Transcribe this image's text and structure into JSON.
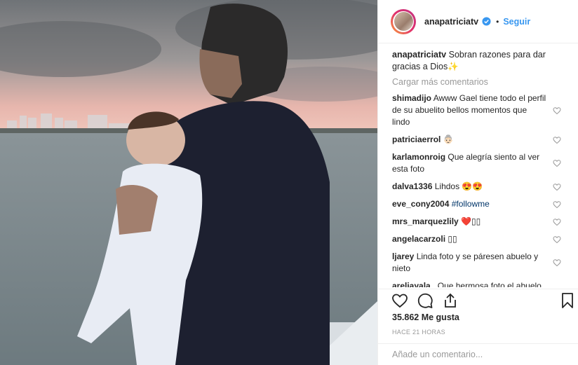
{
  "post": {
    "username": "anapatriciatv",
    "dot": "•",
    "follow_label": "Seguir"
  },
  "caption": {
    "username": "anapatriciatv",
    "text": "Sobran razones para dar gracias a Dios✨"
  },
  "load_more": "Cargar más comentarios",
  "comments": [
    {
      "user": "shimadijo",
      "text": "Awww Gael tiene todo el perfil de su abuelito bellos momentos que lindo"
    },
    {
      "user": "patriciaerrol",
      "text": "👵🏻"
    },
    {
      "user": "karlamonroig",
      "text": "Que alegría siento al ver esta foto"
    },
    {
      "user": "dalva1336",
      "text": "Lihdos 😍😍"
    },
    {
      "user": "eve_cony2004",
      "text": "",
      "hashtag": "#followme"
    },
    {
      "user": "mrs_marquezlily",
      "text": "❤️▯▯"
    },
    {
      "user": "angelacarzoli",
      "text": "▯▯"
    },
    {
      "user": "ljarey",
      "text": "Linda foto y se páresen abuelo y nieto"
    },
    {
      "user": "areliayala_",
      "text": "Que hermosa foto el abuelo feliz con su nieto"
    }
  ],
  "likes": "35.862 Me gusta",
  "time": "HACE 21 HORAS",
  "add_comment_placeholder": "Añade un comentario..."
}
